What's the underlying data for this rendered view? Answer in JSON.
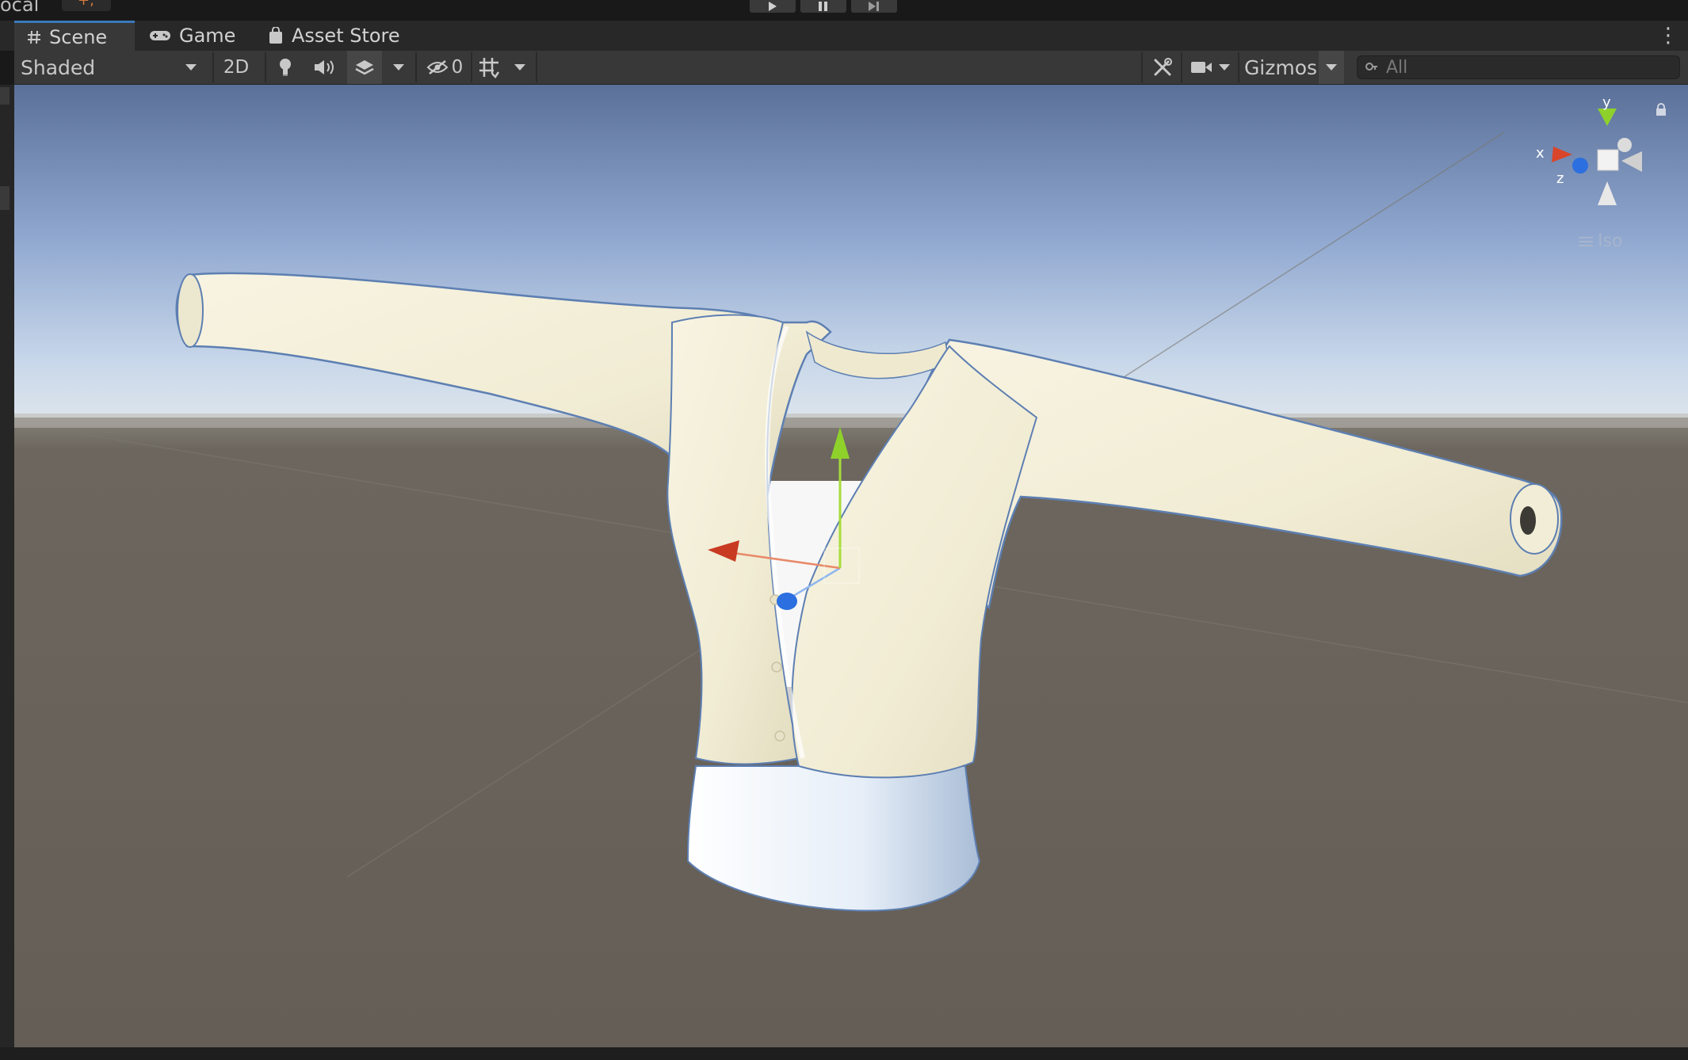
{
  "top_bar": {
    "left_text": "ocal",
    "left_badge": "+,"
  },
  "tabs": [
    {
      "label": "Scene",
      "icon": "hash-grid-icon"
    },
    {
      "label": "Game",
      "icon": "gamepad-icon"
    },
    {
      "label": "Asset Store",
      "icon": "shopping-bag-icon"
    }
  ],
  "toolbar": {
    "shading_mode": "Shaded",
    "two_d_label": "2D",
    "hidden_count": "0",
    "gizmos_label": "Gizmos",
    "search_placeholder": "All"
  },
  "orientation_gizmo": {
    "x_label": "x",
    "y_label": "y",
    "z_label": "z",
    "projection_label": "Iso"
  },
  "colors": {
    "tab_accent": "#3a79bb",
    "sky_top": "#5a7099",
    "horizon": "#dfe6ec",
    "ground": "#655f57",
    "garment": "#f3efd9",
    "axis_x": "#d9452b",
    "axis_y": "#8fd12b",
    "axis_z": "#2b6fe0"
  }
}
